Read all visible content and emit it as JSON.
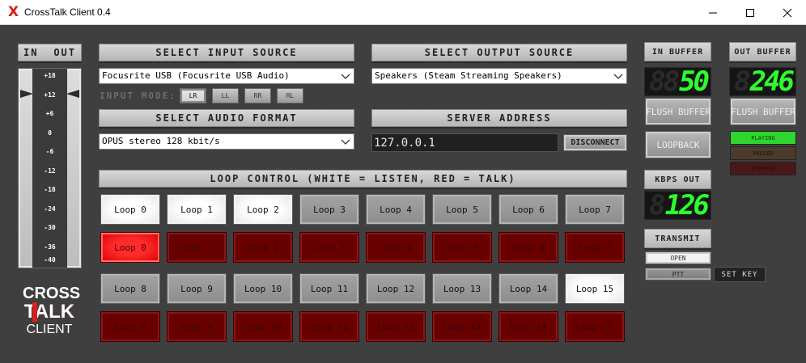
{
  "window": {
    "title": "CrossTalk Client 0.4",
    "logo_glyph": "X",
    "min_icon": "minimize-icon",
    "max_icon": "maximize-icon",
    "close_icon": "close-icon"
  },
  "meter": {
    "in_label": "IN",
    "out_label": "OUT",
    "ticks": [
      "+18",
      "+12",
      "+6",
      "0",
      "-6",
      "-12",
      "-18",
      "-24",
      "-30",
      "-36",
      "-40"
    ]
  },
  "input_source": {
    "header": "SELECT INPUT SOURCE",
    "value": "Focusrite USB (Focusrite USB Audio)"
  },
  "input_mode": {
    "label": "INPUT MODE:",
    "options": [
      "LR",
      "LL",
      "RR",
      "RL"
    ],
    "selected": "LR"
  },
  "output_source": {
    "header": "SELECT OUTPUT SOURCE",
    "value": "Speakers (Steam Streaming Speakers)"
  },
  "audio_format": {
    "header": "SELECT AUDIO FORMAT",
    "value": "OPUS stereo 128 kbit/s"
  },
  "server": {
    "header": "SERVER ADDRESS",
    "value": "127.0.0.1",
    "disconnect_label": "DISCONNECT"
  },
  "loop_control": {
    "header": "LOOP CONTROL (WHITE = LISTEN, RED = TALK)",
    "listen_labels": [
      "Loop 0",
      "Loop 1",
      "Loop 2",
      "Loop 3",
      "Loop 4",
      "Loop 5",
      "Loop 6",
      "Loop 7",
      "Loop 8",
      "Loop 9",
      "Loop 10",
      "Loop 11",
      "Loop 12",
      "Loop 13",
      "Loop 14",
      "Loop 15"
    ],
    "talk_labels": [
      "Loop 0",
      "Loop 1",
      "Loop 2",
      "Loop 3",
      "Loop 4",
      "Loop 5",
      "Loop 6",
      "Loop 7",
      "Loop 8",
      "Loop 9",
      "Loop 10",
      "Loop 11",
      "Loop 12",
      "Loop 13",
      "Loop 14",
      "Loop 15"
    ],
    "listen_active": [
      true,
      true,
      true,
      false,
      false,
      false,
      false,
      false,
      false,
      false,
      false,
      false,
      false,
      false,
      false,
      true
    ],
    "talk_active": [
      true,
      false,
      false,
      false,
      false,
      false,
      false,
      false,
      false,
      false,
      false,
      false,
      false,
      false,
      false,
      false
    ]
  },
  "in_buffer": {
    "header": "IN BUFFER",
    "value": "50",
    "flush_label": "FLUSH BUFFER"
  },
  "out_buffer": {
    "header": "OUT BUFFER",
    "value": "246",
    "flush_label": "FLUSH BUFFER"
  },
  "loopback_label": "LOOPBACK",
  "kbps": {
    "header": "KBPS OUT",
    "value": "126"
  },
  "transmit": {
    "header": "TRANSMIT",
    "open_label": "OPEN",
    "ptt_label": "PTT",
    "set_key_label": "SET KEY"
  },
  "playback_status": {
    "playing": "PLAYING",
    "paused": "PAUSED",
    "stopped": "STOPPED"
  },
  "logo": {
    "line1": "CROSS",
    "line2": "TALK",
    "line3": "CLIENT"
  },
  "colors": {
    "led_green": "#2dff2d",
    "talk_active": "#ff1a1a",
    "talk_idle": "#680000",
    "bg": "#3f3f3f"
  }
}
